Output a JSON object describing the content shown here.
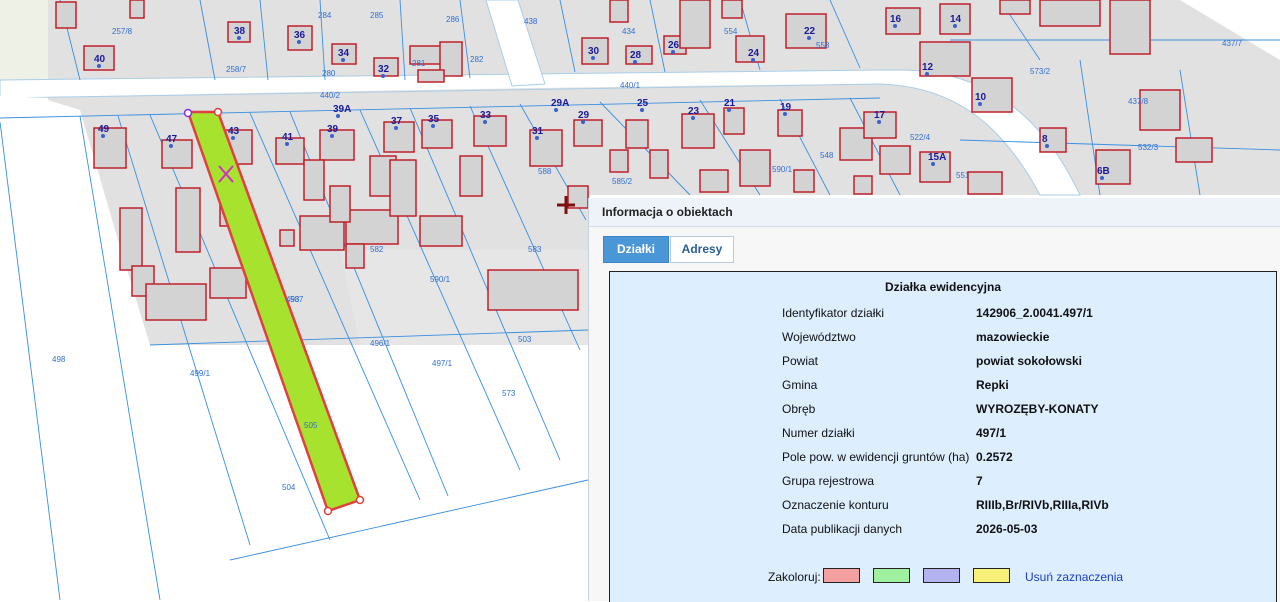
{
  "map": {
    "colors": {
      "background": "#ffffff",
      "built_area": "#e1e1e1",
      "road": "#ffffff",
      "building_fill": "#d3d3d3",
      "building_stroke": "#c0202a",
      "plot_lines": "#3a8fe0",
      "selected_plot": "#a6e22e",
      "house_number": "#1a1a99"
    },
    "house_numbers": [
      "40",
      "38",
      "36",
      "34",
      "32",
      "31",
      "30",
      "28",
      "26",
      "24",
      "22",
      "16",
      "14",
      "12",
      "10",
      "8",
      "6B",
      "49",
      "47",
      "43",
      "41",
      "39",
      "39A",
      "37",
      "35",
      "33",
      "29A",
      "29",
      "25",
      "23",
      "21",
      "19",
      "17",
      "15A"
    ],
    "plot_labels": [
      "257/8",
      "258/7",
      "284",
      "285",
      "286",
      "280",
      "281",
      "282",
      "440/2",
      "440/1",
      "438",
      "434",
      "554",
      "558",
      "573/2",
      "437/7",
      "437/8",
      "532/3",
      "522/4",
      "551",
      "548",
      "590/1",
      "587",
      "588",
      "585/2",
      "583",
      "582",
      "590/1",
      "493",
      "498",
      "496/1",
      "497/1",
      "499/1",
      "505",
      "504",
      "503",
      "573"
    ],
    "marker_icons": [
      "selected-point-icon",
      "crosshair-icon"
    ]
  },
  "panel": {
    "title": "Informacja o obiektach",
    "tabs": [
      {
        "label": "Działki",
        "active": true
      },
      {
        "label": "Adresy",
        "active": false
      }
    ],
    "section_title": "Działka ewidencyjna",
    "rows": [
      {
        "label": "Identyfikator działki",
        "value": "142906_2.0041.497/1"
      },
      {
        "label": "Województwo",
        "value": "mazowieckie"
      },
      {
        "label": "Powiat",
        "value": "powiat sokołowski"
      },
      {
        "label": "Gmina",
        "value": "Repki"
      },
      {
        "label": "Obręb",
        "value": "WYROZĘBY-KONATY"
      },
      {
        "label": "Numer działki",
        "value": "497/1"
      },
      {
        "label": "Pole pow. w ewidencji gruntów (ha)",
        "value": "0.2572"
      },
      {
        "label": "Grupa rejestrowa",
        "value": "7"
      },
      {
        "label": "Oznaczenie konturu",
        "value": "RIIIb,Br/RIVb,RIIIa,RIVb"
      },
      {
        "label": "Data publikacji danych",
        "value": "2026-05-03"
      }
    ],
    "colorize": {
      "label": "Zakoloruj:",
      "swatches": [
        "#f4a0a0",
        "#9ff09f",
        "#b3b3f0",
        "#f7f277"
      ],
      "clear_label": "Usuń zaznaczenia"
    }
  }
}
